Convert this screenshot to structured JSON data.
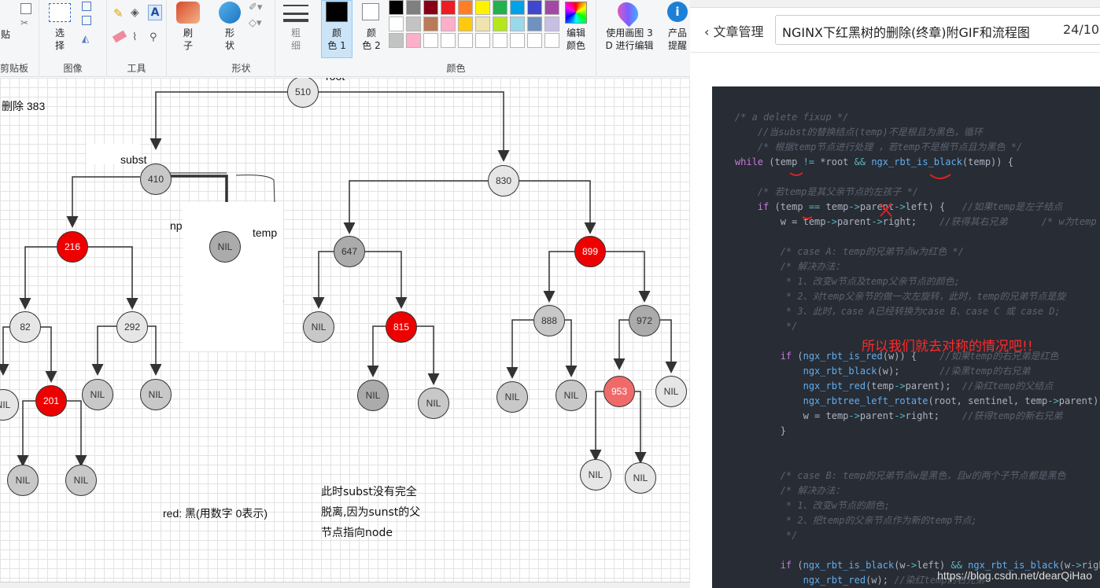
{
  "ribbon": {
    "groups": {
      "clipboard": "剪贴板",
      "image": "图像",
      "tools": "工具",
      "shapes": "形状",
      "colors": "颜色"
    },
    "paste": "贴",
    "select": "选\n择",
    "brush": "刷\n子",
    "shape": "形\n状",
    "outline": "粗\n细",
    "color1": "颜\n色 1",
    "color2": "颜\n色 2",
    "edit_colors": "编辑\n颜色",
    "paint3d": "使用画图 3\nD 进行编辑",
    "product": "产品\n提醒",
    "color1_value": "#000000",
    "color2_value": "#ffffff",
    "palette": [
      "#000000",
      "#7f7f7f",
      "#880015",
      "#ed1c24",
      "#ff7f27",
      "#fff200",
      "#22b14c",
      "#00a2e8",
      "#3f48cc",
      "#a349a4",
      "#ffffff",
      "#c3c3c3",
      "#b97a57",
      "#ffaec9",
      "#ffc90e",
      "#efe4b0",
      "#b5e61d",
      "#99d9ea",
      "#7092be",
      "#c8bfe7",
      "#c3c3c3",
      "#ffaec9",
      "#ffffff",
      "#ffffff",
      "#ffffff",
      "#ffffff",
      "#ffffff",
      "#ffffff",
      "#ffffff",
      "#ffffff"
    ]
  },
  "canvas": {
    "delete_label": "删除 383",
    "root_label": "root",
    "subst_label": "subst",
    "np_label": "np",
    "temp_label": "temp",
    "red_label": "red: 黑(用数字 0表示)",
    "note_lines": [
      "此时subst没有完全",
      "脱离,因为sunst的父",
      "节点指向node"
    ],
    "nodes": [
      {
        "id": "n510",
        "text": "510",
        "color": "light"
      },
      {
        "id": "n410",
        "text": "410",
        "color": "mid"
      },
      {
        "id": "n830",
        "text": "830",
        "color": "light"
      },
      {
        "id": "n216",
        "text": "216",
        "color": "red"
      },
      {
        "id": "nnil_temp",
        "text": "NIL",
        "color": "dark"
      },
      {
        "id": "n647",
        "text": "647",
        "color": "dark"
      },
      {
        "id": "n899",
        "text": "899",
        "color": "red"
      },
      {
        "id": "n82",
        "text": "82",
        "color": "light"
      },
      {
        "id": "n292",
        "text": "292",
        "color": "light"
      },
      {
        "id": "nnil_647l",
        "text": "NIL",
        "color": "mid"
      },
      {
        "id": "n815",
        "text": "815",
        "color": "red"
      },
      {
        "id": "n888",
        "text": "888",
        "color": "mid"
      },
      {
        "id": "n972",
        "text": "972",
        "color": "dark"
      },
      {
        "id": "nnil_82l",
        "text": "NIL",
        "color": "light"
      },
      {
        "id": "n201",
        "text": "201",
        "color": "red"
      },
      {
        "id": "nnil_292l",
        "text": "NIL",
        "color": "mid"
      },
      {
        "id": "nnil_292r",
        "text": "NIL",
        "color": "mid"
      },
      {
        "id": "nnil_815l",
        "text": "NIL",
        "color": "dark"
      },
      {
        "id": "nnil_815r",
        "text": "NIL",
        "color": "mid"
      },
      {
        "id": "nnil_888l",
        "text": "NIL",
        "color": "mid"
      },
      {
        "id": "nnil_888r",
        "text": "NIL",
        "color": "mid"
      },
      {
        "id": "n953",
        "text": "953",
        "color": "pink"
      },
      {
        "id": "nnil_972r",
        "text": "NIL",
        "color": "light"
      },
      {
        "id": "nnil_201l",
        "text": "NIL",
        "color": "mid"
      },
      {
        "id": "nnil_201r",
        "text": "NIL",
        "color": "mid"
      },
      {
        "id": "nnil_953l",
        "text": "NIL",
        "color": "light"
      },
      {
        "id": "nnil_953r",
        "text": "NIL",
        "color": "light"
      }
    ]
  },
  "article": {
    "back": "文章管理",
    "title": "NGINX下红黑树的删除(终章)附GIF和流程图",
    "counter": "24/10",
    "overlay": "所以我们就去对称的情况吧!!",
    "watermark": "https://blog.csdn.net/dearQiHao",
    "code": [
      {
        "indent": "    ",
        "parts": [
          {
            "t": "/* a delete fixup */",
            "c": "cmt"
          }
        ]
      },
      {
        "indent": "        ",
        "parts": [
          {
            "t": "//当subst的替换结点(temp)不是根且为黑色，循环",
            "c": "cmt"
          }
        ]
      },
      {
        "indent": "        ",
        "parts": [
          {
            "t": "/* 根据temp节点进行处理 ，若temp不是根节点且为黑色 */",
            "c": "cmt"
          }
        ]
      },
      {
        "indent": "    ",
        "parts": [
          {
            "t": "while",
            "c": "kw"
          },
          {
            "t": " (temp ",
            "c": ""
          },
          {
            "t": "!=",
            "c": "op"
          },
          {
            "t": " *root ",
            "c": ""
          },
          {
            "t": "&&",
            "c": "op"
          },
          {
            "t": " ",
            "c": ""
          },
          {
            "t": "ngx_rbt_is_black",
            "c": "fn"
          },
          {
            "t": "(temp)) {",
            "c": ""
          }
        ]
      },
      {
        "indent": "",
        "parts": [
          {
            "t": "",
            "c": ""
          }
        ]
      },
      {
        "indent": "        ",
        "parts": [
          {
            "t": "/* 若temp是其父亲节点的左孩子 */",
            "c": "cmt"
          }
        ]
      },
      {
        "indent": "        ",
        "parts": [
          {
            "t": "if",
            "c": "kw"
          },
          {
            "t": " (temp ",
            "c": ""
          },
          {
            "t": "==",
            "c": "op"
          },
          {
            "t": " temp",
            "c": ""
          },
          {
            "t": "->",
            "c": "op"
          },
          {
            "t": "parent",
            "c": ""
          },
          {
            "t": "->",
            "c": "op"
          },
          {
            "t": "left) {   ",
            "c": ""
          },
          {
            "t": "//如果temp是左子结点",
            "c": "cmt"
          }
        ]
      },
      {
        "indent": "            ",
        "parts": [
          {
            "t": "w = temp",
            "c": ""
          },
          {
            "t": "->",
            "c": "op"
          },
          {
            "t": "parent",
            "c": ""
          },
          {
            "t": "->",
            "c": "op"
          },
          {
            "t": "right;    ",
            "c": ""
          },
          {
            "t": "//获得其右兄弟      /* w为temp",
            "c": "cmt"
          }
        ]
      },
      {
        "indent": "",
        "parts": [
          {
            "t": "",
            "c": ""
          }
        ]
      },
      {
        "indent": "            ",
        "parts": [
          {
            "t": "/* case A: temp的兄弟节点w为红色 */",
            "c": "cmt"
          }
        ]
      },
      {
        "indent": "            ",
        "parts": [
          {
            "t": "/* 解决办法：",
            "c": "cmt"
          }
        ]
      },
      {
        "indent": "             ",
        "parts": [
          {
            "t": "* 1、改变w节点及temp父亲节点的颜色;",
            "c": "cmt"
          }
        ]
      },
      {
        "indent": "             ",
        "parts": [
          {
            "t": "* 2、对temp父亲节的做一次左旋转，此时，temp的兄弟节点是旋",
            "c": "cmt"
          }
        ]
      },
      {
        "indent": "             ",
        "parts": [
          {
            "t": "* 3、此时，case A已经转换为case B、case C 或 case D;",
            "c": "cmt"
          }
        ]
      },
      {
        "indent": "             ",
        "parts": [
          {
            "t": "*/",
            "c": "cmt"
          }
        ]
      },
      {
        "indent": "",
        "parts": [
          {
            "t": "",
            "c": ""
          }
        ]
      },
      {
        "indent": "            ",
        "parts": [
          {
            "t": "if",
            "c": "kw"
          },
          {
            "t": " (",
            "c": ""
          },
          {
            "t": "ngx_rbt_is_red",
            "c": "fn"
          },
          {
            "t": "(w)) {    ",
            "c": ""
          },
          {
            "t": "//如果temp的右兄弟是红色",
            "c": "cmt"
          }
        ]
      },
      {
        "indent": "                ",
        "parts": [
          {
            "t": "ngx_rbt_black",
            "c": "fn"
          },
          {
            "t": "(w);       ",
            "c": ""
          },
          {
            "t": "//染黑temp的右兄弟",
            "c": "cmt"
          }
        ]
      },
      {
        "indent": "                ",
        "parts": [
          {
            "t": "ngx_rbt_red",
            "c": "fn"
          },
          {
            "t": "(temp",
            "c": ""
          },
          {
            "t": "->",
            "c": "op"
          },
          {
            "t": "parent);  ",
            "c": ""
          },
          {
            "t": "//染红temp的父结点",
            "c": "cmt"
          }
        ]
      },
      {
        "indent": "                ",
        "parts": [
          {
            "t": "ngx_rbtree_left_rotate",
            "c": "fn"
          },
          {
            "t": "(root, sentinel, temp",
            "c": ""
          },
          {
            "t": "->",
            "c": "op"
          },
          {
            "t": "parent);",
            "c": ""
          }
        ]
      },
      {
        "indent": "                ",
        "parts": [
          {
            "t": "w = temp",
            "c": ""
          },
          {
            "t": "->",
            "c": "op"
          },
          {
            "t": "parent",
            "c": ""
          },
          {
            "t": "->",
            "c": "op"
          },
          {
            "t": "right;    ",
            "c": ""
          },
          {
            "t": "//获得temp的新右兄弟",
            "c": "cmt"
          }
        ]
      },
      {
        "indent": "            ",
        "parts": [
          {
            "t": "}",
            "c": ""
          }
        ]
      },
      {
        "indent": "",
        "parts": [
          {
            "t": "",
            "c": ""
          }
        ]
      },
      {
        "indent": "",
        "parts": [
          {
            "t": "",
            "c": ""
          }
        ]
      },
      {
        "indent": "            ",
        "parts": [
          {
            "t": "/* case B: temp的兄弟节点w是黑色，且w的两个子节点都是黑色",
            "c": "cmt"
          }
        ]
      },
      {
        "indent": "            ",
        "parts": [
          {
            "t": "/* 解决办法：",
            "c": "cmt"
          }
        ]
      },
      {
        "indent": "             ",
        "parts": [
          {
            "t": "* 1、改变w节点的颜色;",
            "c": "cmt"
          }
        ]
      },
      {
        "indent": "             ",
        "parts": [
          {
            "t": "* 2、把temp的父亲节点作为新的temp节点;",
            "c": "cmt"
          }
        ]
      },
      {
        "indent": "             ",
        "parts": [
          {
            "t": "*/",
            "c": "cmt"
          }
        ]
      },
      {
        "indent": "",
        "parts": [
          {
            "t": "",
            "c": ""
          }
        ]
      },
      {
        "indent": "            ",
        "parts": [
          {
            "t": "if",
            "c": "kw"
          },
          {
            "t": " (",
            "c": ""
          },
          {
            "t": "ngx_rbt_is_black",
            "c": "fn"
          },
          {
            "t": "(w",
            "c": ""
          },
          {
            "t": "->",
            "c": "op"
          },
          {
            "t": "left) ",
            "c": ""
          },
          {
            "t": "&&",
            "c": "op"
          },
          {
            "t": " ",
            "c": ""
          },
          {
            "t": "ngx_rbt_is_black",
            "c": "fn"
          },
          {
            "t": "(w",
            "c": ""
          },
          {
            "t": "->",
            "c": "op"
          },
          {
            "t": "right",
            "c": ""
          }
        ]
      },
      {
        "indent": "                ",
        "parts": [
          {
            "t": "ngx_rbt_red",
            "c": "fn"
          },
          {
            "t": "(w); ",
            "c": ""
          },
          {
            "t": "//染红temp的右兄弟",
            "c": "cmt"
          }
        ]
      }
    ]
  }
}
